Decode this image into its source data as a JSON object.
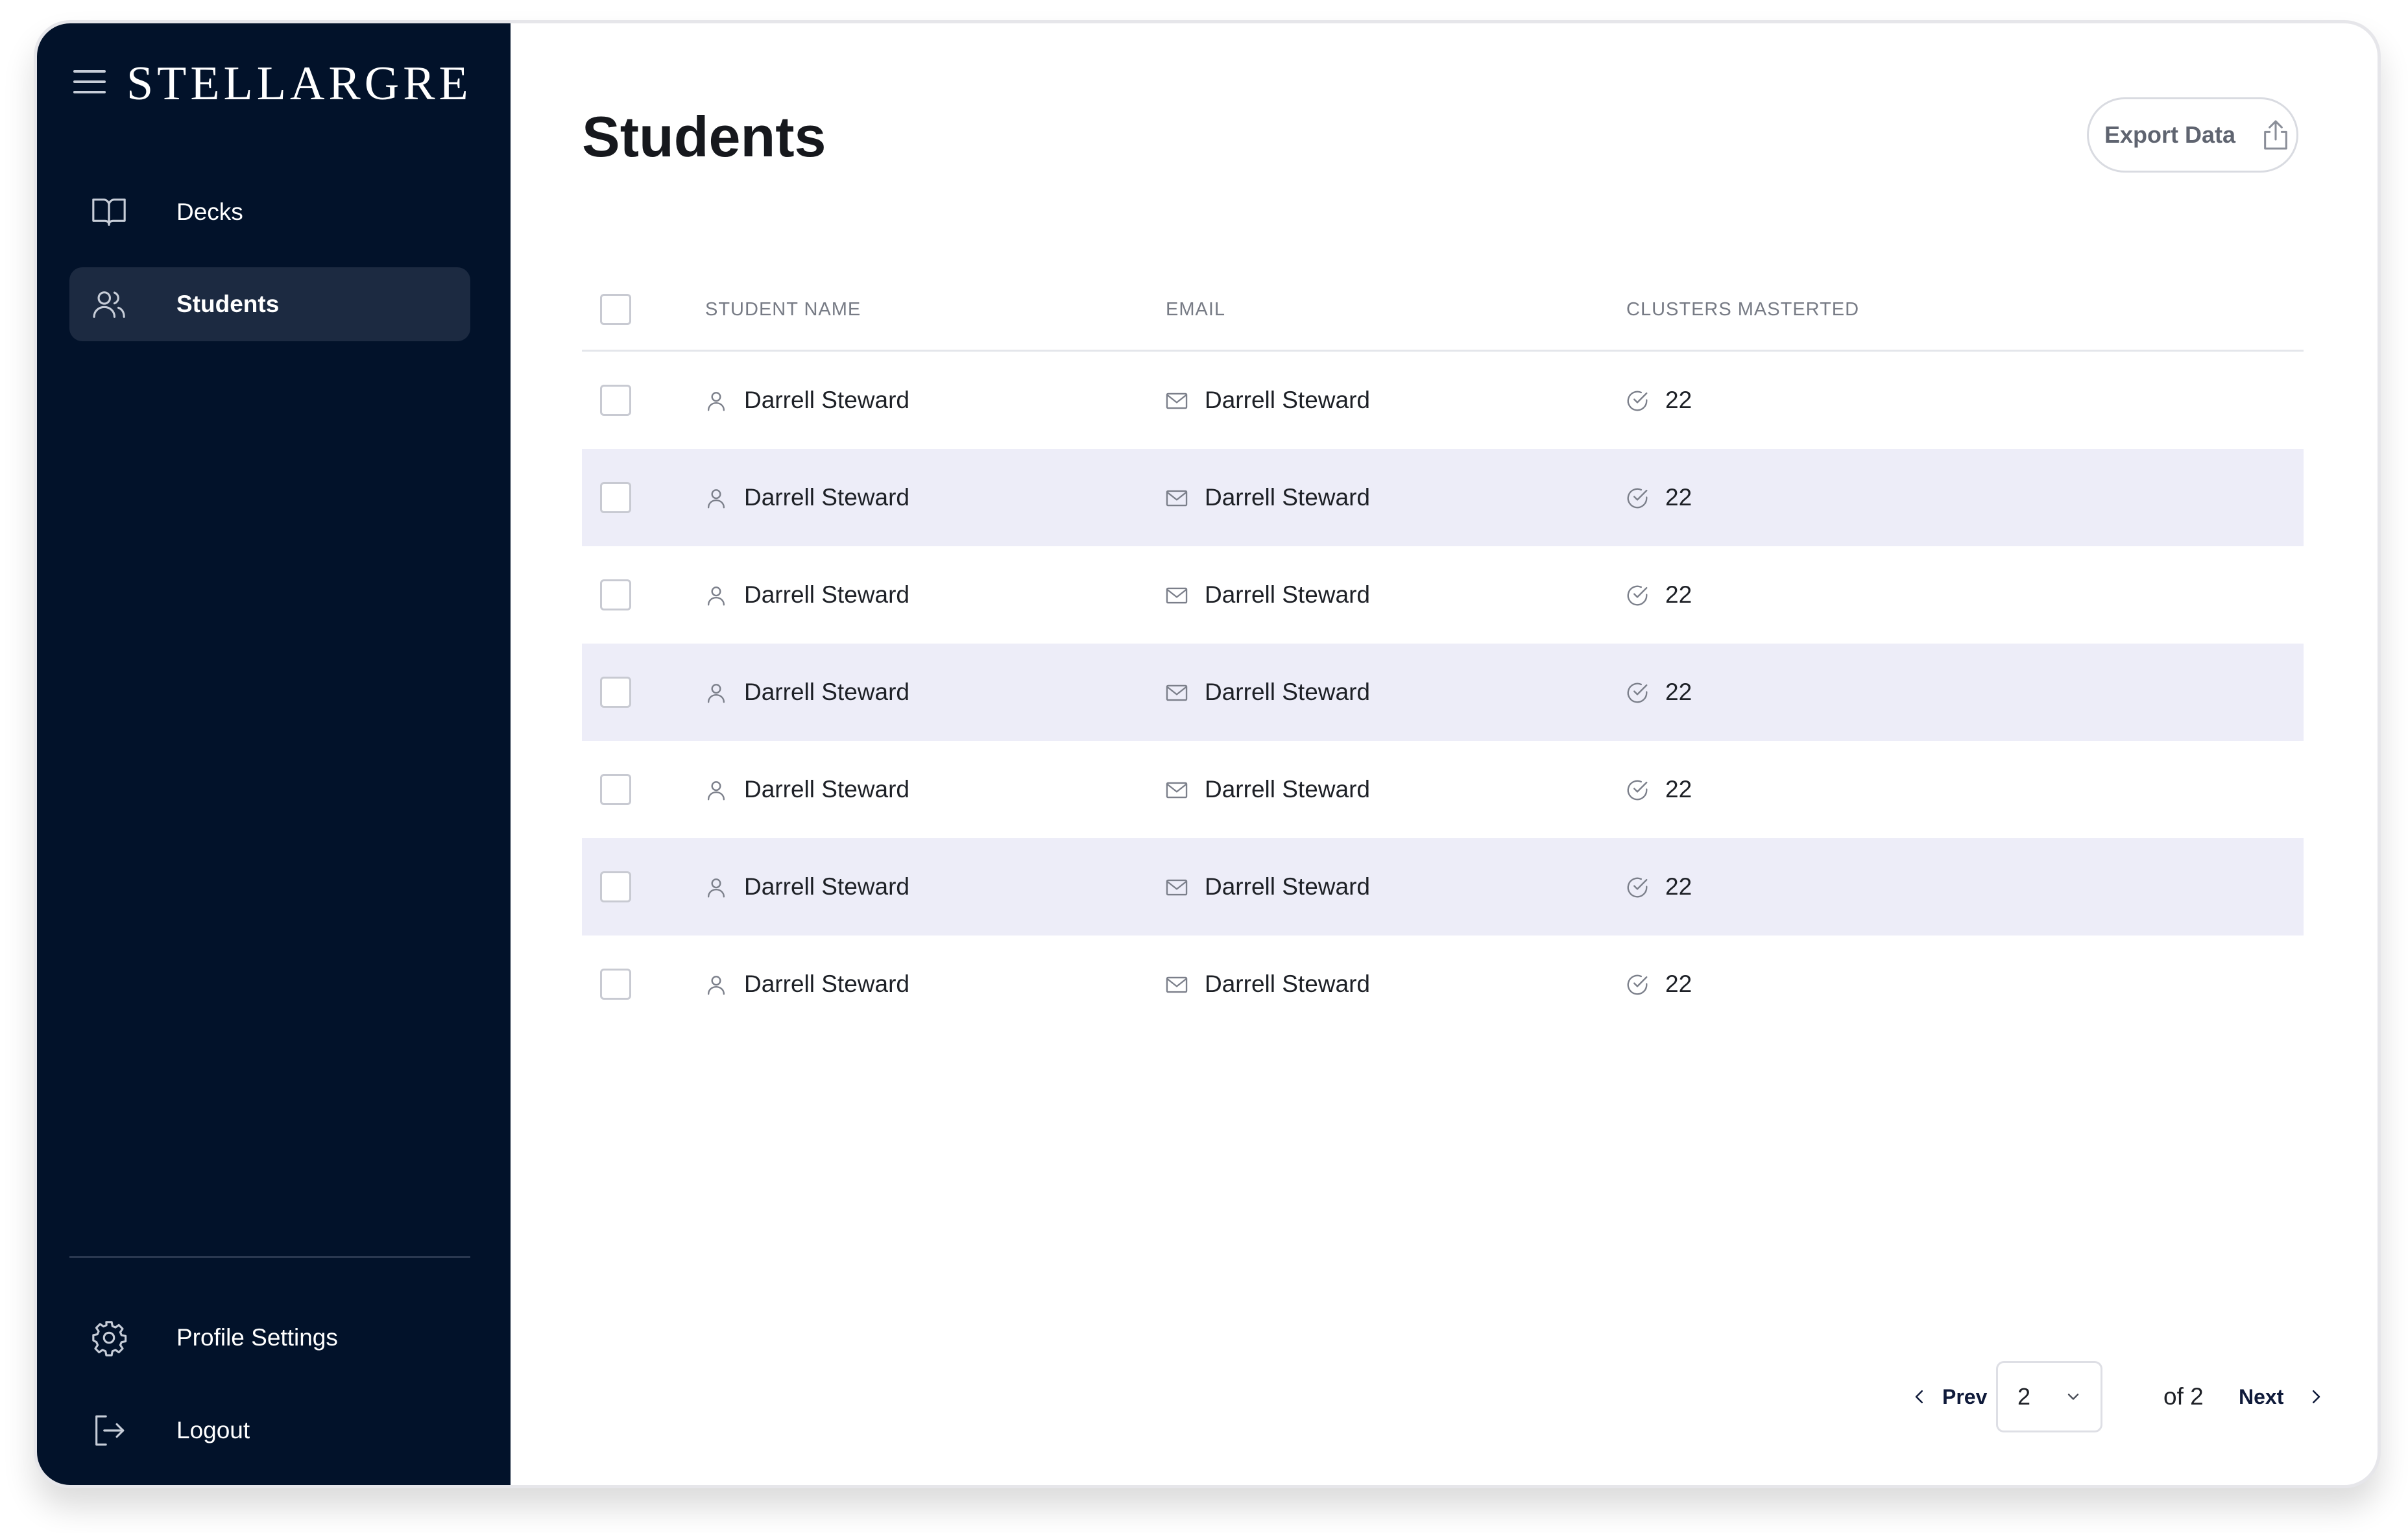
{
  "app": {
    "brand": "STELLARGRE",
    "menu_icon": "menu-icon"
  },
  "sidebar": {
    "items": [
      {
        "label": "Decks",
        "icon": "book-open-icon",
        "active": false
      },
      {
        "label": "Students",
        "icon": "users-icon",
        "active": true
      }
    ],
    "bottom_items": [
      {
        "label": "Profile Settings",
        "icon": "gear-icon"
      },
      {
        "label": "Logout",
        "icon": "logout-icon"
      }
    ]
  },
  "header": {
    "title": "Students",
    "export_label": "Export Data",
    "export_icon": "upload-icon"
  },
  "table": {
    "columns": [
      "STUDENT NAME",
      "EMAIL",
      "CLUSTERS MASTERTED"
    ],
    "rows": [
      {
        "name": "Darrell Steward",
        "email": "Darrell Steward",
        "clusters": "22"
      },
      {
        "name": "Darrell Steward",
        "email": "Darrell Steward",
        "clusters": "22"
      },
      {
        "name": "Darrell Steward",
        "email": "Darrell Steward",
        "clusters": "22"
      },
      {
        "name": "Darrell Steward",
        "email": "Darrell Steward",
        "clusters": "22"
      },
      {
        "name": "Darrell Steward",
        "email": "Darrell Steward",
        "clusters": "22"
      },
      {
        "name": "Darrell Steward",
        "email": "Darrell Steward",
        "clusters": "22"
      },
      {
        "name": "Darrell Steward",
        "email": "Darrell Steward",
        "clusters": "22"
      }
    ]
  },
  "pagination": {
    "prev_label": "Prev",
    "next_label": "Next",
    "current_page": "2",
    "of_label": "of 2"
  },
  "colors": {
    "sidebar_bg": "#02122a",
    "sidebar_active": "#1c2a41",
    "row_shade": "#ededf8",
    "text": "#1d2026",
    "muted": "#777b85"
  }
}
